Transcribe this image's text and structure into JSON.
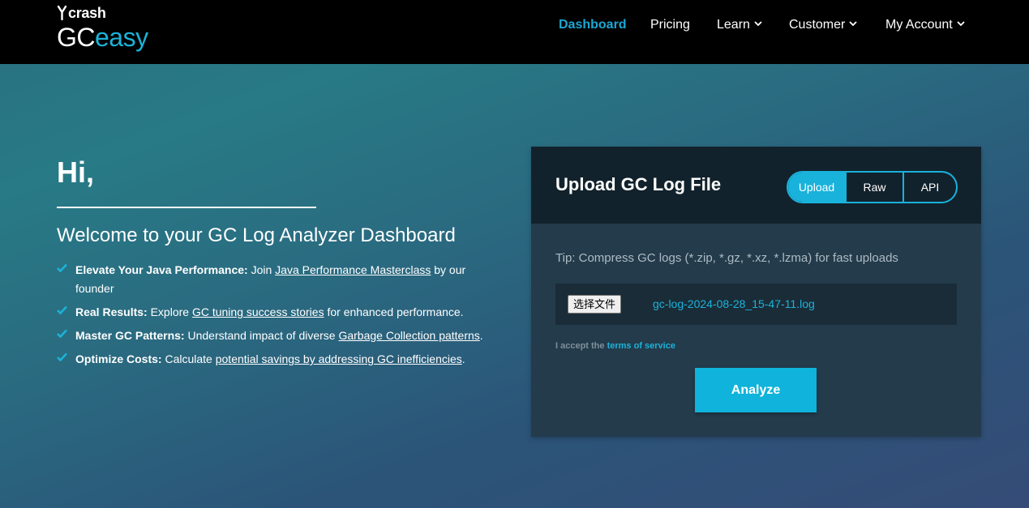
{
  "header": {
    "logo": {
      "brand_small": "crash",
      "brand_gc": "GC",
      "brand_easy": "easy"
    },
    "nav": [
      {
        "label": "Dashboard",
        "active": true,
        "has_dropdown": false
      },
      {
        "label": "Pricing",
        "active": false,
        "has_dropdown": false
      },
      {
        "label": "Learn",
        "active": false,
        "has_dropdown": true
      },
      {
        "label": "Customer",
        "active": false,
        "has_dropdown": true
      },
      {
        "label": "My Account",
        "active": false,
        "has_dropdown": true
      }
    ]
  },
  "welcome": {
    "greeting": "Hi,",
    "title": "Welcome to your GC Log Analyzer Dashboard",
    "features": [
      {
        "bold": "Elevate Your Java Performance:",
        "pre": " Join ",
        "link": "Java Performance Masterclass",
        "post": " by our founder"
      },
      {
        "bold": "Real Results:",
        "pre": " Explore ",
        "link": "GC tuning success stories",
        "post": " for enhanced performance."
      },
      {
        "bold": "Master GC Patterns:",
        "pre": " Understand impact of diverse ",
        "link": "Garbage Collection patterns",
        "post": "."
      },
      {
        "bold": "Optimize Costs:",
        "pre": " Calculate ",
        "link": "potential savings by addressing GC inefficiencies",
        "post": "."
      }
    ]
  },
  "upload": {
    "title": "Upload GC Log File",
    "tabs": [
      {
        "label": "Upload",
        "active": true
      },
      {
        "label": "Raw",
        "active": false
      },
      {
        "label": "API",
        "active": false
      }
    ],
    "tip": "Tip: Compress GC logs (*.zip, *.gz, *.xz, *.lzma) for fast uploads",
    "file_button": "选择文件",
    "file_name": "gc-log-2024-08-28_15-47-11.log",
    "terms_prefix": "I accept the ",
    "terms_link": "terms of service",
    "analyze_label": "Analyze"
  },
  "colors": {
    "accent": "#1bb3d8",
    "header_bg": "#000000",
    "card_bg": "#233b4b",
    "card_head_bg": "#12222c"
  }
}
